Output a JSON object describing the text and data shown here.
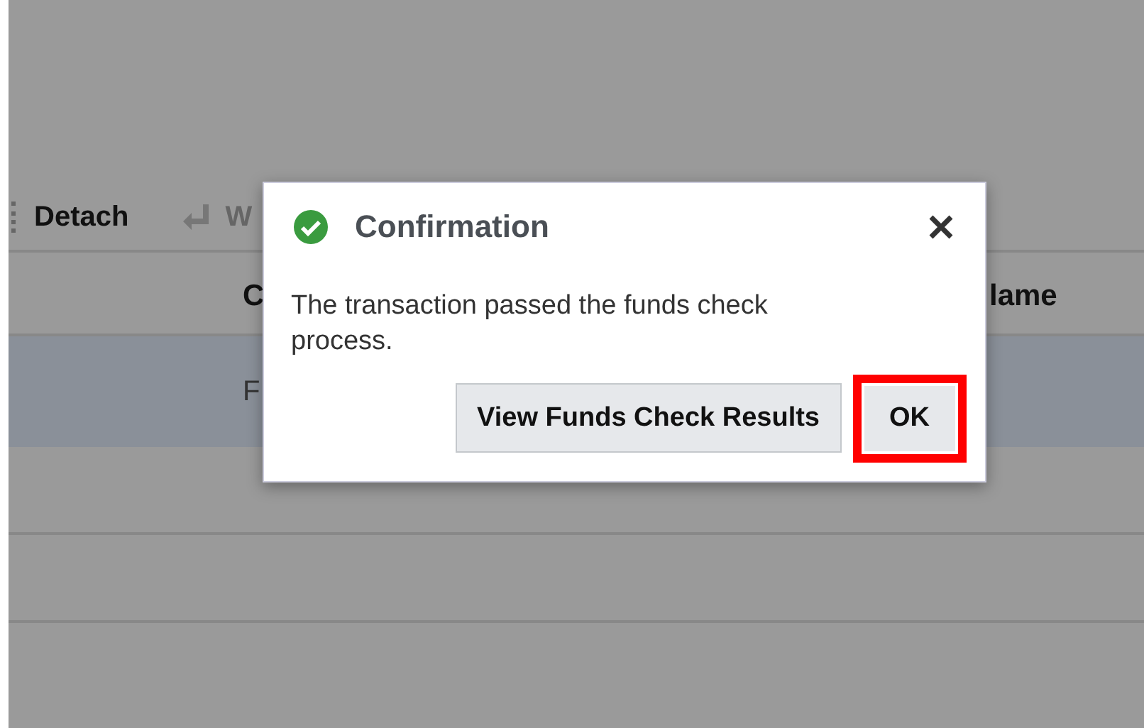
{
  "toolbar": {
    "items": [
      {
        "label": "Detach",
        "kind": "text"
      },
      {
        "label": "W",
        "kind": "icon-text"
      }
    ]
  },
  "table": {
    "columns": [
      "C",
      "lame"
    ],
    "rows": [
      {
        "cells": [
          "F"
        ],
        "selected": true
      },
      {
        "selected": false
      },
      {
        "selected": false
      }
    ]
  },
  "dialog": {
    "title": "Confirmation",
    "message": "The transaction passed the funds check process.",
    "buttons": [
      {
        "label": "View Funds Check Results",
        "highlighted": false
      },
      {
        "label": "OK",
        "highlighted": true
      }
    ]
  }
}
